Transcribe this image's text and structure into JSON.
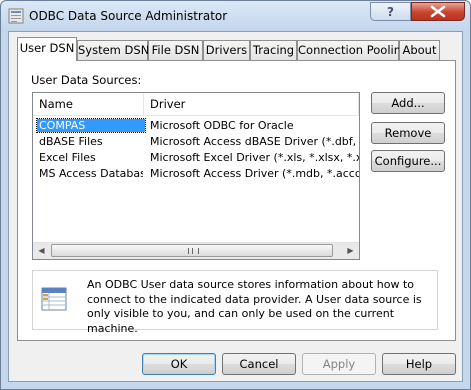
{
  "window": {
    "title": "ODBC Data Source Administrator",
    "help_label": "?"
  },
  "tabs": [
    {
      "label": "User DSN",
      "active": true
    },
    {
      "label": "System DSN",
      "active": false
    },
    {
      "label": "File DSN",
      "active": false
    },
    {
      "label": "Drivers",
      "active": false
    },
    {
      "label": "Tracing",
      "active": false
    },
    {
      "label": "Connection Pooling",
      "active": false
    },
    {
      "label": "About",
      "active": false
    }
  ],
  "user_dsn": {
    "section_label": "User Data Sources:",
    "columns": {
      "name": "Name",
      "driver": "Driver"
    },
    "rows": [
      {
        "name": "COMPAS",
        "driver": "Microsoft ODBC for Oracle",
        "selected": true
      },
      {
        "name": "dBASE Files",
        "driver": "Microsoft Access dBASE Driver (*.dbf, *.ndx",
        "selected": false
      },
      {
        "name": "Excel Files",
        "driver": "Microsoft Excel Driver (*.xls, *.xlsx, *.xlsm, *.x",
        "selected": false
      },
      {
        "name": "MS Access Database",
        "driver": "Microsoft Access Driver (*.mdb, *.accdb)",
        "selected": false
      }
    ],
    "buttons": {
      "add": "Add...",
      "remove": "Remove",
      "configure": "Configure..."
    },
    "info_text": "An ODBC User data source stores information about how to connect to the indicated data provider.   A User data source is only visible to you, and can only be used on the current machine."
  },
  "footer": {
    "ok": "OK",
    "cancel": "Cancel",
    "apply": "Apply",
    "help": "Help"
  },
  "icons": {
    "app": "odbc-admin-icon",
    "info": "data-source-table-icon",
    "scroll_left": "scroll-left-arrow-icon",
    "scroll_right": "scroll-right-arrow-icon"
  },
  "colors": {
    "selection": "#3399ff",
    "close_button": "#c7442f",
    "title_bar": "#c3d6ec"
  }
}
